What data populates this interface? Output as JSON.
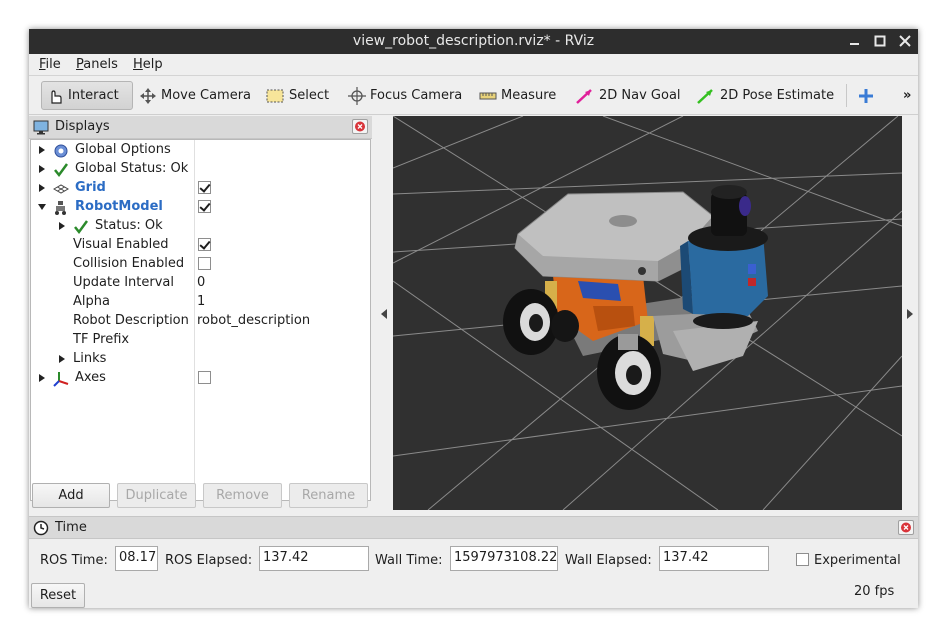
{
  "window": {
    "title": "view_robot_description.rviz* - RViz"
  },
  "menu": [
    "File",
    "Panels",
    "Help"
  ],
  "toolbar": {
    "interact": "Interact",
    "move_camera": "Move Camera",
    "select": "Select",
    "focus_camera": "Focus Camera",
    "measure": "Measure",
    "nav_goal": "2D Nav Goal",
    "pose_estimate": "2D Pose Estimate",
    "overflow": "»"
  },
  "displays": {
    "title": "Displays",
    "rows": [
      {
        "name": "Global Options",
        "value": ""
      },
      {
        "name": "Global Status: Ok",
        "value": ""
      },
      {
        "name": "Grid",
        "value": ""
      },
      {
        "name": "RobotModel",
        "value": ""
      },
      {
        "name": "Status: Ok",
        "value": ""
      },
      {
        "name": "Visual Enabled",
        "value": ""
      },
      {
        "name": "Collision Enabled",
        "value": ""
      },
      {
        "name": "Update Interval",
        "value": "0"
      },
      {
        "name": "Alpha",
        "value": "1"
      },
      {
        "name": "Robot Description",
        "value": "robot_description"
      },
      {
        "name": "TF Prefix",
        "value": ""
      },
      {
        "name": "Links",
        "value": ""
      },
      {
        "name": "Axes",
        "value": ""
      }
    ],
    "checkboxes": {
      "grid": true,
      "robot_model": true,
      "visual_enabled": true,
      "collision_enabled": false,
      "axes": false
    },
    "buttons": {
      "add": "Add",
      "duplicate": "Duplicate",
      "remove": "Remove",
      "rename": "Rename"
    }
  },
  "time": {
    "title": "Time",
    "ros_time_label": "ROS Time:",
    "ros_time": "08.17",
    "ros_elapsed_label": "ROS Elapsed:",
    "ros_elapsed": "137.42",
    "wall_time_label": "Wall Time:",
    "wall_time": "1597973108.22",
    "wall_elapsed_label": "Wall Elapsed:",
    "wall_elapsed": "137.42",
    "experimental_label": "Experimental",
    "experimental_checked": false,
    "reset": "Reset",
    "fps": "20 fps"
  },
  "colors": {
    "viewport_bg": "#303030",
    "grid_line": "#8a8a8a",
    "robot_blue": "#2a6aa0",
    "robot_orange": "#d8661a",
    "link_blue": "#2b6cc4"
  }
}
